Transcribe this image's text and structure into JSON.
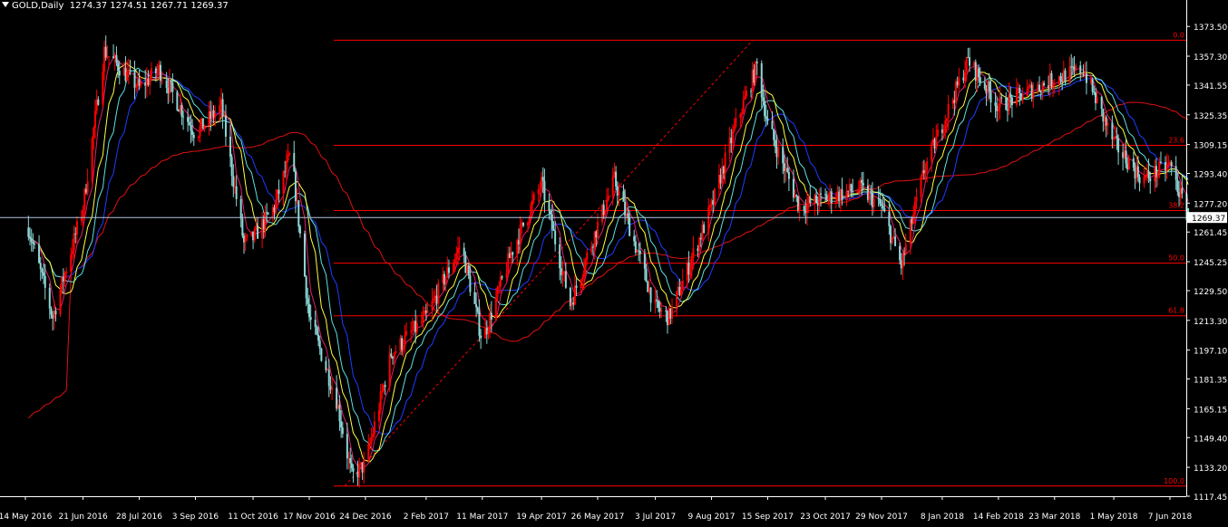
{
  "header": {
    "symbol": "GOLD,Daily",
    "ohlc": "1274.37 1274.51 1267.71 1269.37"
  },
  "colors": {
    "background": "#000000",
    "candle": "#8ED7D7",
    "fibo": "#FF0000",
    "ma_slow": "#E01010",
    "ma_blue": "#1E3CFF",
    "ma_cyan": "#5FE0E0",
    "ma_yellow": "#FFFF40",
    "ma_pink": "#E0206A",
    "price_line": "#B0C4DE"
  },
  "chart_data": {
    "type": "candlestick",
    "symbol": "GOLD",
    "timeframe": "Daily",
    "last_ohlc": {
      "open": 1274.37,
      "high": 1274.51,
      "low": 1267.71,
      "close": 1269.37
    },
    "current_price": 1269.37,
    "ylim": [
      1117.45,
      1382
    ],
    "y_ticks": [
      "1373.50",
      "1357.30",
      "1341.55",
      "1325.35",
      "1309.15",
      "1293.40",
      "1277.20",
      "1261.45",
      "1245.25",
      "1229.50",
      "1213.30",
      "1197.10",
      "1181.35",
      "1165.15",
      "1149.40",
      "1133.20",
      "1117.45"
    ],
    "x_ticks": [
      "14 May 2016",
      "21 Jun 2016",
      "28 Jul 2016",
      "3 Sep 2016",
      "11 Oct 2016",
      "17 Nov 2016",
      "24 Dec 2016",
      "2 Feb 2017",
      "11 Mar 2017",
      "19 Apr 2017",
      "26 May 2017",
      "3 Jul 2017",
      "9 Aug 2017",
      "15 Sep 2017",
      "23 Oct 2017",
      "29 Nov 2017",
      "8 Jan 2018",
      "14 Feb 2018",
      "23 Mar 2018",
      "1 May 2018",
      "7 Jun 2018"
    ],
    "fibonacci": {
      "high": 1366,
      "low": 1123,
      "levels": [
        {
          "label": "0.0",
          "price": 1366
        },
        {
          "label": "23.6",
          "price": 1308.7
        },
        {
          "label": "38.2",
          "price": 1273.2
        },
        {
          "label": "50.0",
          "price": 1244.5
        },
        {
          "label": "61.8",
          "price": 1215.8
        },
        {
          "label": "100.0",
          "price": 1123
        }
      ]
    },
    "price_anchors": [
      [
        "14 May 2016",
        1270
      ],
      [
        "1 Jun 2016",
        1215
      ],
      [
        "21 Jun 2016",
        1275
      ],
      [
        "5 Jul 2016",
        1360
      ],
      [
        "28 Jul 2016",
        1340
      ],
      [
        "10 Aug 2016",
        1350
      ],
      [
        "3 Sep 2016",
        1315
      ],
      [
        "20 Sep 2016",
        1330
      ],
      [
        "5 Oct 2016",
        1255
      ],
      [
        "11 Oct 2016",
        1258
      ],
      [
        "25 Oct 2016",
        1275
      ],
      [
        "5 Nov 2016",
        1305
      ],
      [
        "17 Nov 2016",
        1215
      ],
      [
        "5 Dec 2016",
        1170
      ],
      [
        "15 Dec 2016",
        1128
      ],
      [
        "24 Dec 2016",
        1135
      ],
      [
        "10 Jan 2017",
        1195
      ],
      [
        "2 Feb 2017",
        1215
      ],
      [
        "25 Feb 2017",
        1255
      ],
      [
        "11 Mar 2017",
        1202
      ],
      [
        "30 Mar 2017",
        1250
      ],
      [
        "19 Apr 2017",
        1288
      ],
      [
        "8 May 2017",
        1222
      ],
      [
        "26 May 2017",
        1265
      ],
      [
        "6 Jun 2017",
        1290
      ],
      [
        "3 Jul 2017",
        1220
      ],
      [
        "12 Jul 2017",
        1215
      ],
      [
        "9 Aug 2017",
        1275
      ],
      [
        "25 Aug 2017",
        1320
      ],
      [
        "8 Sep 2017",
        1352
      ],
      [
        "15 Sep 2017",
        1320
      ],
      [
        "6 Oct 2017",
        1275
      ],
      [
        "23 Oct 2017",
        1280
      ],
      [
        "15 Nov 2017",
        1285
      ],
      [
        "29 Nov 2017",
        1275
      ],
      [
        "12 Dec 2017",
        1243
      ],
      [
        "27 Dec 2017",
        1295
      ],
      [
        "8 Jan 2018",
        1320
      ],
      [
        "25 Jan 2018",
        1355
      ],
      [
        "14 Feb 2018",
        1330
      ],
      [
        "23 Mar 2018",
        1345
      ],
      [
        "11 Apr 2018",
        1350
      ],
      [
        "1 May 2018",
        1310
      ],
      [
        "20 May 2018",
        1290
      ],
      [
        "7 Jun 2018",
        1298
      ],
      [
        "19 Jun 2018",
        1269.37
      ]
    ]
  }
}
